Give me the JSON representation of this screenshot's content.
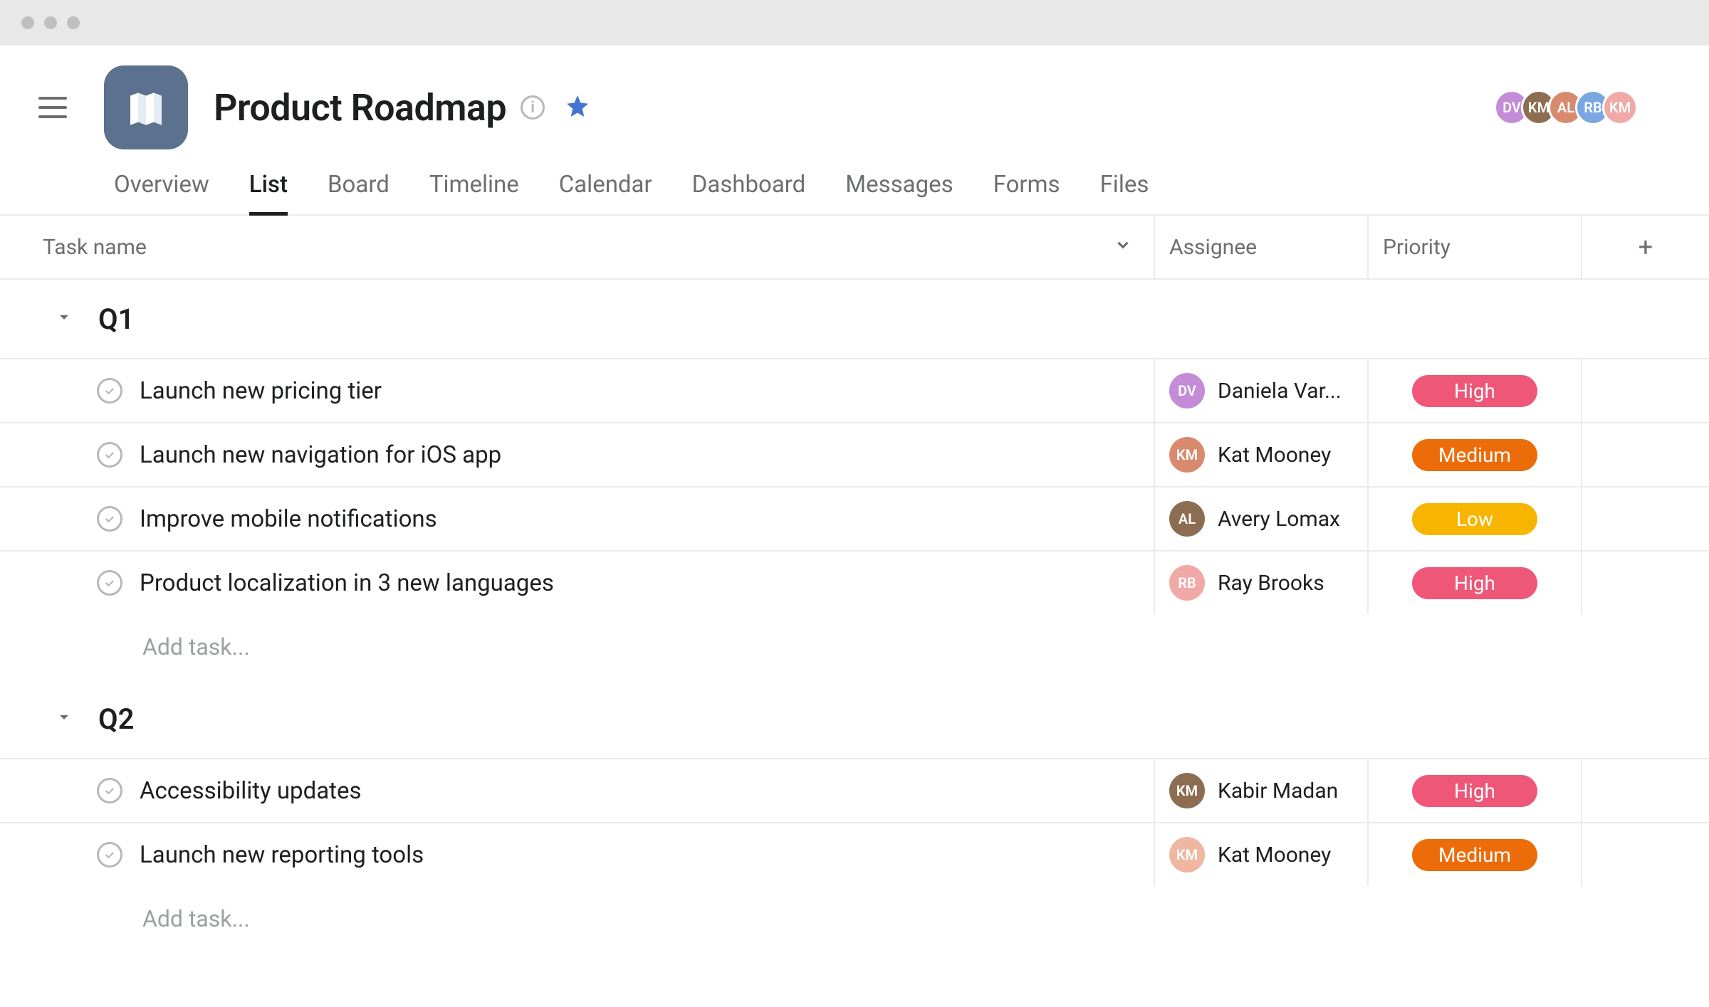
{
  "project": {
    "title": "Product Roadmap",
    "starred": true
  },
  "members": [
    {
      "initials": "DV",
      "color": "#c48bd6"
    },
    {
      "initials": "KM",
      "color": "#8c6d52"
    },
    {
      "initials": "AL",
      "color": "#d88a6e"
    },
    {
      "initials": "RB",
      "color": "#7aa7e0"
    },
    {
      "initials": "KM",
      "color": "#f0a9a6"
    }
  ],
  "tabs": [
    {
      "label": "Overview",
      "active": false
    },
    {
      "label": "List",
      "active": true
    },
    {
      "label": "Board",
      "active": false
    },
    {
      "label": "Timeline",
      "active": false
    },
    {
      "label": "Calendar",
      "active": false
    },
    {
      "label": "Dashboard",
      "active": false
    },
    {
      "label": "Messages",
      "active": false
    },
    {
      "label": "Forms",
      "active": false
    },
    {
      "label": "Files",
      "active": false
    }
  ],
  "columns": {
    "task": "Task name",
    "assignee": "Assignee",
    "priority": "Priority"
  },
  "add_task_placeholder": "Add task...",
  "priority_labels": {
    "high": "High",
    "medium": "Medium",
    "low": "Low"
  },
  "sections": [
    {
      "title": "Q1",
      "tasks": [
        {
          "name": "Launch new pricing tier",
          "assignee": {
            "name": "Daniela Var...",
            "initials": "DV",
            "color": "#c48bd6"
          },
          "priority": "high"
        },
        {
          "name": "Launch new navigation for iOS app",
          "assignee": {
            "name": "Kat Mooney",
            "initials": "KM",
            "color": "#d88a6e"
          },
          "priority": "medium"
        },
        {
          "name": "Improve mobile notifications",
          "assignee": {
            "name": "Avery Lomax",
            "initials": "AL",
            "color": "#8c6d52"
          },
          "priority": "low"
        },
        {
          "name": "Product localization in 3 new languages",
          "assignee": {
            "name": "Ray Brooks",
            "initials": "RB",
            "color": "#f0a9a6"
          },
          "priority": "high"
        }
      ]
    },
    {
      "title": "Q2",
      "tasks": [
        {
          "name": "Accessibility updates",
          "assignee": {
            "name": "Kabir Madan",
            "initials": "KM",
            "color": "#8c6d52"
          },
          "priority": "high"
        },
        {
          "name": "Launch new reporting tools",
          "assignee": {
            "name": "Kat Mooney",
            "initials": "KM",
            "color": "#f0b7a0"
          },
          "priority": "medium"
        }
      ]
    }
  ]
}
